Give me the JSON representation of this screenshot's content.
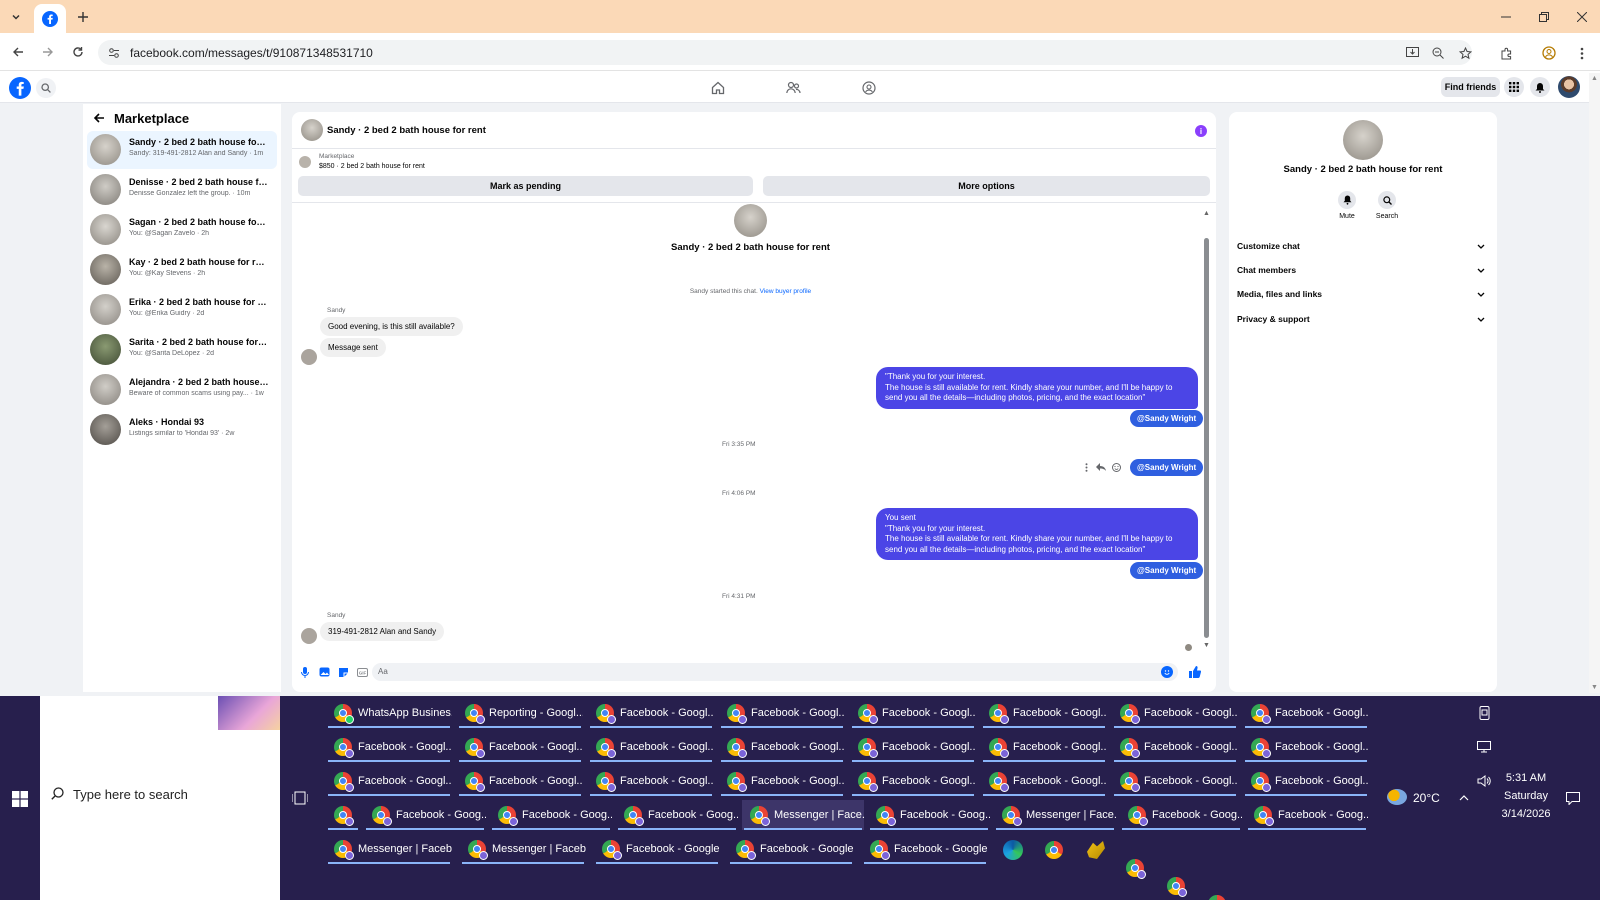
{
  "browser": {
    "url": "facebook.com/messages/t/910871348531710"
  },
  "fb_header": {
    "find_friends": "Find friends"
  },
  "sidebar": {
    "title": "Marketplace",
    "conversations": [
      {
        "title": "Sandy · 2 bed 2 bath house for rent",
        "preview": "Sandy: 319-491-2812 Alan and Sandy · 1m",
        "active": true
      },
      {
        "title": "Denisse · 2 bed 2 bath house for r...",
        "preview": "Denisse Gonzalez left the group. · 10m"
      },
      {
        "title": "Sagan · 2 bed 2 bath house for rent",
        "preview": "You: @Sagan Zavelo · 2h"
      },
      {
        "title": "Kay · 2 bed 2 bath house for rent",
        "preview": "You: @Kay Stevens · 2h"
      },
      {
        "title": "Erika · 2 bed 2 bath house for rent",
        "preview": "You: @Erika Guidry · 2d"
      },
      {
        "title": "Sarita · 2 bed 2 bath house for rent",
        "preview": "You: @Sarita DeLópez · 2d"
      },
      {
        "title": "Alejandra · 2 bed 2 bath house for ...",
        "preview": "Beware of common scams using pay... · 1w"
      },
      {
        "title": "Aleks · Hondai 93",
        "preview": "Listings similar to 'Hondai 93' · 2w"
      }
    ]
  },
  "chat": {
    "header_title": "Sandy · 2 bed 2 bath house for rent",
    "listing_label": "Marketplace",
    "listing_title": "$850 · 2 bed 2 bath house for rent",
    "mark_pending": "Mark as pending",
    "more_options": "More options",
    "intro_name": "Sandy · 2 bed 2 bath house for rent",
    "started_text": "Sandy started this chat.",
    "view_profile": "View buyer profile",
    "sender_name_1": "Sandy",
    "msg_in_1": "Good evening, is this still available?",
    "msg_in_2": "Message sent",
    "msg_out_1": [
      "\"Thank you for your interest.",
      "The house is still available for rent. Kindly share your number, and I'll be happy to",
      "send you all the details—including photos, pricing, and the exact location\""
    ],
    "mention": "@Sandy Wright",
    "time_1": "Fri 3:35 PM",
    "time_2": "Fri 4:06 PM",
    "msg_out_2": [
      "You sent",
      "\"Thank you for your interest.",
      "The house is still available for rent. Kindly share your number, and I'll be happy to",
      "send you all the details—including photos, pricing, and the exact location\""
    ],
    "time_3": "Fri 4:31 PM",
    "sender_name_2": "Sandy",
    "msg_in_3": "319-491-2812  Alan and Sandy",
    "composer_placeholder": "Aa"
  },
  "details": {
    "name": "Sandy · 2 bed 2 bath house for rent",
    "mute": "Mute",
    "search": "Search",
    "sections": [
      "Customize chat",
      "Chat members",
      "Media, files and links",
      "Privacy & support"
    ]
  },
  "taskbar": {
    "search_placeholder": "Type here to search",
    "rows": [
      [
        "WhatsApp Busines...",
        "Reporting - Googl...",
        "Facebook - Googl...",
        "Facebook - Googl...",
        "Facebook - Googl...",
        "Facebook - Googl...",
        "Facebook - Googl...",
        "Facebook - Googl..."
      ],
      [
        "Facebook - Googl...",
        "Facebook - Googl...",
        "Facebook - Googl...",
        "Facebook - Googl...",
        "Facebook - Googl...",
        "Facebook - Googl...",
        "Facebook - Googl...",
        "Facebook - Googl..."
      ],
      [
        "Facebook - Googl...",
        "Facebook - Googl...",
        "Facebook - Googl...",
        "Facebook - Googl...",
        "Facebook - Googl...",
        "Facebook - Googl...",
        "Facebook - Googl...",
        "Facebook - Googl..."
      ],
      [
        "Facebook - Goog...",
        "Facebook - Goog...",
        "Facebook - Goog...",
        "Messenger | Face...",
        "Facebook - Goog...",
        "Messenger | Face...",
        "Facebook - Goog...",
        "Facebook - Goog..."
      ],
      [
        "Messenger | Faceb...",
        "Messenger | Faceb...",
        "Facebook - Google ...",
        "Facebook - Google ...",
        "Facebook - Google ..."
      ]
    ],
    "weather": "20°C",
    "time": "5:31 AM",
    "day": "Saturday",
    "date": "3/14/2026"
  },
  "colors": {
    "fb_blue": "#0866ff",
    "outgoing_bubble": "#4b45e6",
    "mention_bubble": "#2f5fe0",
    "tab_strip": "#fbd9b7",
    "taskbar": "#271f4d"
  }
}
